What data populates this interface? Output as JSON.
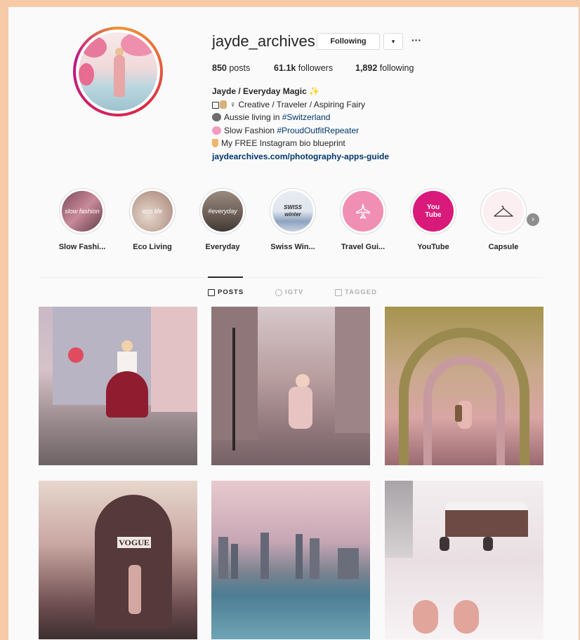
{
  "profile": {
    "username": "jayde_archives",
    "following_button": "Following",
    "dropdown_icon": "▾",
    "more_icon": "···",
    "stats": {
      "posts_count": "850",
      "posts_label": " posts",
      "followers_count": "61.1k",
      "followers_label": " followers",
      "following_count": "1,892",
      "following_label": " following"
    },
    "bio": {
      "name": "Jayde / Everyday Magic ✨",
      "line1": "♀ Creative / Traveler / Aspiring Fairy",
      "line2_text": "Aussie living in ",
      "line2_tag": "#Switzerland",
      "line3_text": "Slow Fashion ",
      "line3_tag": "#ProudOutfitRepeater",
      "line4": "My FREE Instagram bio blueprint",
      "link": "jaydearchives.com/photography-apps-guide"
    }
  },
  "highlights": [
    {
      "label": "Slow Fashi...",
      "cover_text": "slow fashion"
    },
    {
      "label": "Eco Living",
      "cover_text": "eco life"
    },
    {
      "label": "Everyday",
      "cover_text": "#everyday"
    },
    {
      "label": "Swiss Win...",
      "cover_text": "SWISS winter"
    },
    {
      "label": "Travel Gui...",
      "cover_text": ""
    },
    {
      "label": "YouTube",
      "cover_text": "You Tube"
    },
    {
      "label": "Capsule",
      "cover_text": ""
    }
  ],
  "tabs": [
    {
      "label": "POSTS",
      "active": true
    },
    {
      "label": "IGTV",
      "active": false
    },
    {
      "label": "TAGGED",
      "active": false
    }
  ],
  "kiosk_sign": "VOGUE",
  "colors": {
    "link": "#00376b",
    "border": "#dbdbdb",
    "page_border": "#f6c9a7"
  }
}
